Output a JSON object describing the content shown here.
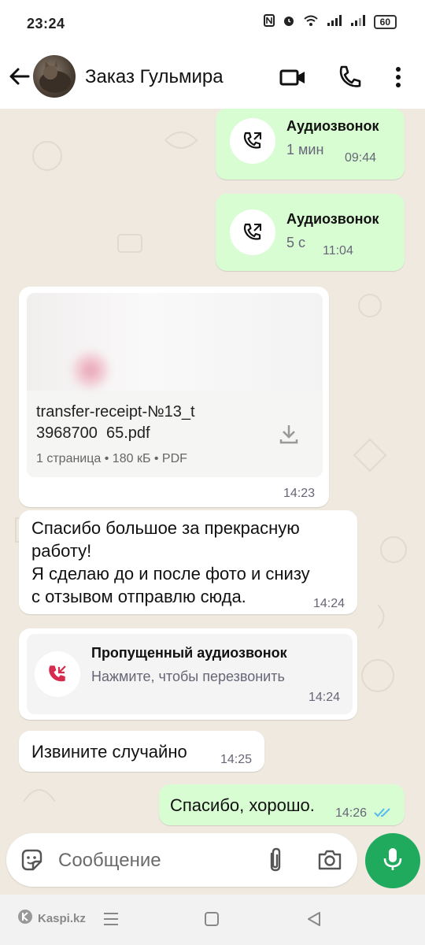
{
  "status_bar": {
    "time": "23:24",
    "battery": "60"
  },
  "header": {
    "title": "Заказ Гульмира"
  },
  "messages": {
    "call1": {
      "title": "Аудиозвонок",
      "duration": "1 мин",
      "time": "09:44"
    },
    "call2": {
      "title": "Аудиозвонок",
      "duration": "5 с",
      "time": "11:04"
    },
    "document": {
      "name_line1": "transfer-receipt-№13_t",
      "name_line2": "3968700 ⁠‍⁠ ‍⁠65.pdf",
      "meta": "1 страница • 180 кБ • PDF",
      "time": "14:23"
    },
    "text1": {
      "lines": [
        "Спасибо большое за прекрасную",
        "работу!",
        "Я сделаю до и после фото и снизу",
        "с отзывом отправлю сюда."
      ],
      "time": "14:24"
    },
    "missed_call": {
      "title": "Пропущенный аудиозвонок",
      "subtitle": "Нажмите, чтобы перезвонить",
      "time": "14:24"
    },
    "text2": {
      "text": "Извините случайно",
      "time": "14:25"
    },
    "text3": {
      "text": "Спасибо, хорошо.",
      "time": "14:26"
    }
  },
  "composer": {
    "placeholder": "Сообщение"
  },
  "watermark": {
    "text": "Kaspi.kz"
  },
  "colors": {
    "accent": "#1faa5e",
    "outgoing": "#d9fdd3",
    "missed": "#d62d4f",
    "read_ticks": "#53bdeb"
  }
}
